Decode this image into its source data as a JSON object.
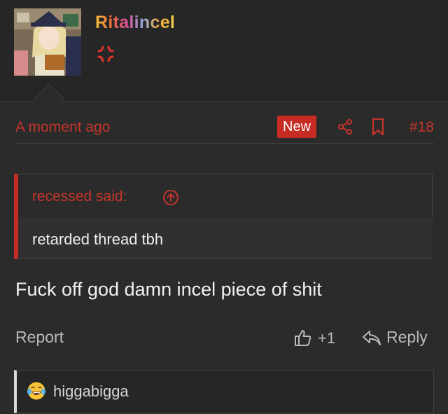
{
  "post": {
    "username": "Ritalincel",
    "time": "A moment ago",
    "new_badge": "New",
    "number": "#18",
    "quote": {
      "header": "recessed said:",
      "text": "retarded thread tbh"
    },
    "message": "Fuck off god damn incel piece of shit",
    "actions": {
      "report": "Report",
      "like_count": "+1",
      "reply": "Reply"
    },
    "reactions": {
      "emoji": "crying-laughing-emoji",
      "users": "higgabigga"
    }
  },
  "colors": {
    "accent": "#c4352b",
    "badge": "#c62c23",
    "background": "#2b2b2b"
  }
}
